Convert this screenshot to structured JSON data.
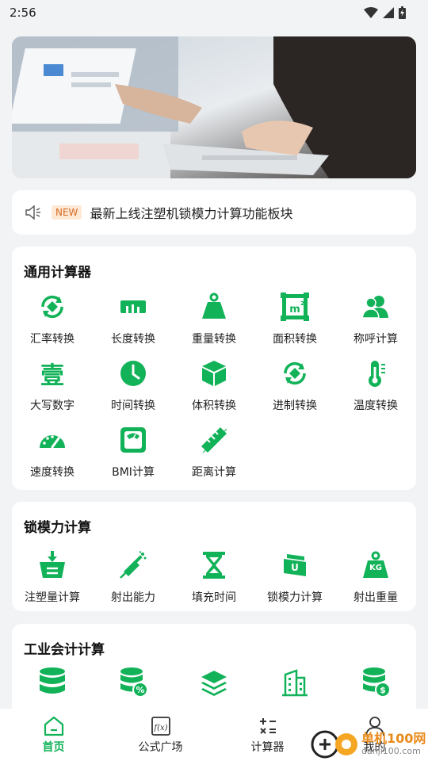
{
  "status": {
    "time": "2:56"
  },
  "notice": {
    "tag": "NEW",
    "text": "最新上线注塑机锁模力计算功能板块"
  },
  "sections": [
    {
      "title": "通用计算器",
      "items": [
        {
          "label": "汇率转换",
          "icon": "exchange-icon"
        },
        {
          "label": "长度转换",
          "icon": "ruler-icon"
        },
        {
          "label": "重量转换",
          "icon": "weight-icon"
        },
        {
          "label": "面积转换",
          "icon": "area-icon"
        },
        {
          "label": "称呼计算",
          "icon": "people-icon"
        },
        {
          "label": "大写数字",
          "icon": "chinese-numeral-icon",
          "glyph": "壹"
        },
        {
          "label": "时间转换",
          "icon": "clock-icon"
        },
        {
          "label": "体积转换",
          "icon": "cube-icon"
        },
        {
          "label": "进制转换",
          "icon": "base-convert-icon"
        },
        {
          "label": "温度转换",
          "icon": "thermometer-icon"
        },
        {
          "label": "速度转换",
          "icon": "speedometer-icon"
        },
        {
          "label": "BMI计算",
          "icon": "scale-icon"
        },
        {
          "label": "距离计算",
          "icon": "distance-ruler-icon"
        }
      ]
    },
    {
      "title": "锁模力计算",
      "items": [
        {
          "label": "注塑量计算",
          "icon": "injection-volume-icon"
        },
        {
          "label": "射出能力",
          "icon": "syringe-icon"
        },
        {
          "label": "填充时间",
          "icon": "hourglass-icon"
        },
        {
          "label": "锁模力计算",
          "icon": "clamp-force-icon"
        },
        {
          "label": "射出重量",
          "icon": "kg-weight-icon",
          "glyph": "KG"
        }
      ]
    },
    {
      "title": "工业会计计算",
      "items": [
        {
          "label": "",
          "icon": "database-icon"
        },
        {
          "label": "",
          "icon": "percent-coins-icon"
        },
        {
          "label": "",
          "icon": "layers-icon"
        },
        {
          "label": "",
          "icon": "building-icon"
        },
        {
          "label": "",
          "icon": "dollar-coins-icon"
        }
      ]
    }
  ],
  "tabs": [
    {
      "label": "首页",
      "icon": "home-icon",
      "active": true
    },
    {
      "label": "公式广场",
      "icon": "formula-icon"
    },
    {
      "label": "计算器",
      "icon": "calculator-icon"
    },
    {
      "label": "我的",
      "icon": "user-icon"
    }
  ],
  "watermark": {
    "text1": "单机100网",
    "text2": "danji100.com"
  },
  "colors": {
    "accent": "#12b259",
    "background": "#f2f3f5"
  }
}
